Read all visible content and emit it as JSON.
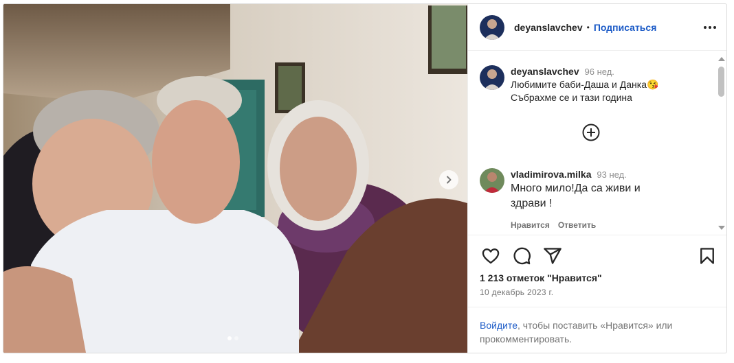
{
  "post": {
    "username": "deyanslavchev",
    "separator": "•",
    "follow_label": "Подписаться",
    "caption": {
      "username": "deyanslavchev",
      "time": "96 нед.",
      "line1": "Любимите баби-Даша и Данка",
      "emoji": "😘",
      "line2": "Събрахме се и тази година"
    },
    "comments": [
      {
        "username": "vladimirova.milka",
        "time": "93 нед.",
        "line1": "Много мило!Да са живи и",
        "line2": "здрави !",
        "like_label": "Нравится",
        "reply_label": "Ответить"
      }
    ],
    "likes_text": "1 213 отметок \"Нравится\"",
    "date": "10 декабрь 2023 г.",
    "login": {
      "link": "Войдите",
      "rest_line1": ", чтобы поставить «Нравится» или",
      "line2": "прокомментировать."
    }
  },
  "icons": {
    "like": "heart-icon",
    "comment": "comment-icon",
    "share": "share-icon",
    "save": "bookmark-icon",
    "more": "more-options-icon",
    "next": "chevron-right-icon",
    "load_more": "plus-circle-icon"
  },
  "colors": {
    "link_blue": "#1c5bc7",
    "muted": "#737373",
    "text": "#262626"
  },
  "carousel": {
    "total": 2,
    "active": 1
  }
}
